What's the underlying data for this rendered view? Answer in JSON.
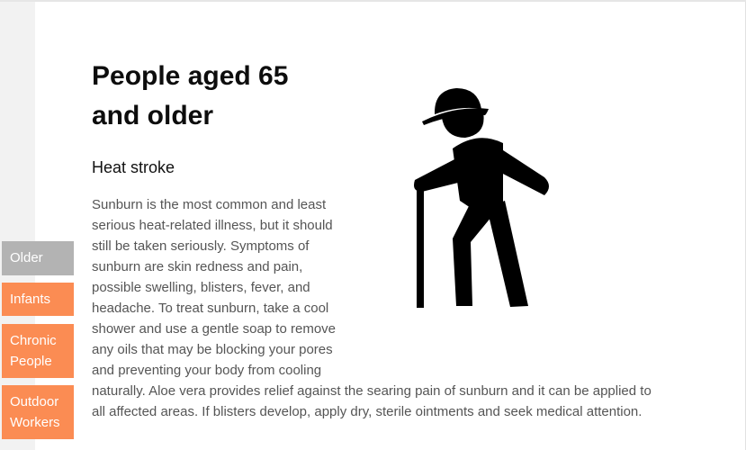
{
  "page": {
    "title": "People aged 65 and older",
    "subtitle": "Heat stroke",
    "body": "Sunburn is the most common and least serious heat-related illness, but it should still be taken seriously. Symptoms of sunburn are skin redness and pain, possible swelling, blisters, fever, and headache. To treat sunburn, take a cool shower and use a gentle soap to remove any oils that may be blocking your pores and preventing your body from cooling naturally. Aloe vera provides relief against the searing pain of sunburn and it can be applied to all affected areas. If blisters develop, apply dry, sterile ointments and seek medical attention."
  },
  "nav": {
    "items": [
      {
        "label": "Older",
        "state": "selected",
        "color": "#b3b3b3"
      },
      {
        "label": "Infants",
        "color": "#fb8c53"
      },
      {
        "label": "Chronic\nPeople",
        "color": "#fb8c53"
      },
      {
        "label": "Outdoor\nWorkers",
        "color": "#fb8c53"
      }
    ]
  },
  "icons": {
    "main_figure": "elderly-person-with-cane-icon"
  }
}
